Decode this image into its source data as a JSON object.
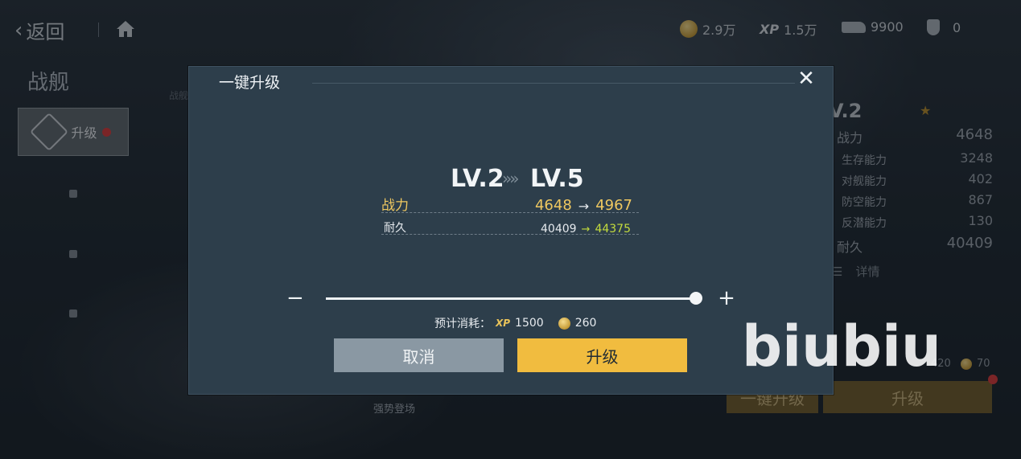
{
  "topbar": {
    "back_label": "返回",
    "coins": "2.9万",
    "xp": "1.5万",
    "ship_count": "9900",
    "trophy": "0"
  },
  "left": {
    "title": "战舰",
    "tab_upgrade": "升级",
    "side_label": "战舰"
  },
  "right_stats": {
    "level": "V.2",
    "power_label": "战力",
    "power": "4648",
    "items": [
      {
        "label": "生存能力",
        "value": "3248"
      },
      {
        "label": "对舰能力",
        "value": "402"
      },
      {
        "label": "防空能力",
        "value": "867"
      },
      {
        "label": "反潜能力",
        "value": "130"
      }
    ],
    "dur_label": "耐久",
    "dur": "40409",
    "details": "详情",
    "cost_xp": "420",
    "cost_coin": "70",
    "btn_onekey": "一键升级",
    "btn_upgrade": "升级"
  },
  "bottom_tabs": [
    "强势登场"
  ],
  "modal": {
    "title": "一键升级",
    "lv_from": "LV.2",
    "lv_to": "LV.5",
    "arrows": "»»",
    "power_label": "战力",
    "power_old": "4648",
    "power_new": "4967",
    "dur_label": "耐久",
    "dur_old": "40409",
    "dur_new": "44375",
    "arrow": "→",
    "minus": "−",
    "plus": "+",
    "slider_fraction": 1.0,
    "cost_label": "预计消耗：",
    "cost_xp_icon": "XP",
    "cost_xp": "1500",
    "cost_coin": "260",
    "cancel": "取消",
    "upgrade": "升级"
  },
  "watermark": "biubiu",
  "colors": {
    "accent_gold": "#f1bc3f",
    "power_yellow": "#efc860",
    "dur_green": "#c4dc3d",
    "modal_bg": "#2d3e4b",
    "badge_red": "#d83a3a"
  }
}
